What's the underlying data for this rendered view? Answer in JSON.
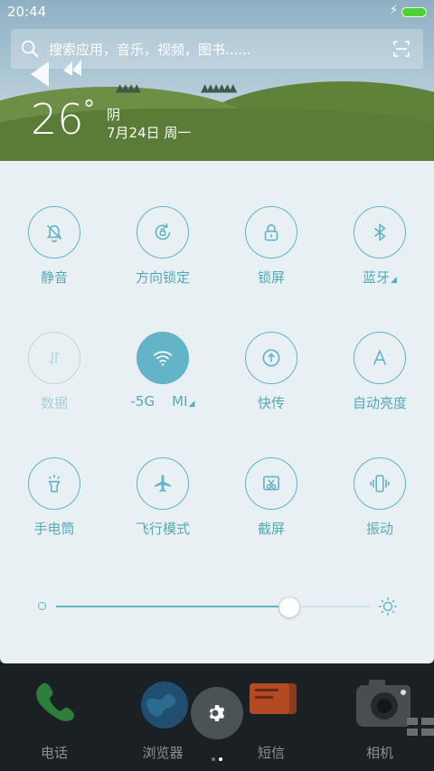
{
  "status": {
    "time": "20:44",
    "charging_icon": "bolt-icon",
    "battery_color": "#4cd137"
  },
  "search": {
    "placeholder": "搜索应用，音乐，视频，图书......"
  },
  "weather": {
    "temperature": "26",
    "degree": "°",
    "condition": "阴",
    "date": "7月24日 周一"
  },
  "toggles": [
    {
      "label": "静音",
      "icon": "bell-off-icon",
      "state": "off"
    },
    {
      "label": "方向锁定",
      "icon": "rotation-lock-icon",
      "state": "off"
    },
    {
      "label": "锁屏",
      "icon": "lock-icon",
      "state": "off"
    },
    {
      "label": "蓝牙",
      "icon": "bluetooth-icon",
      "state": "off",
      "has_submenu": true
    },
    {
      "label": "数据",
      "icon": "data-arrows-icon",
      "state": "disabled"
    },
    {
      "label": "-5G    MI",
      "icon": "wifi-icon",
      "state": "on",
      "has_submenu": true
    },
    {
      "label": "快传",
      "icon": "share-upload-icon",
      "state": "off"
    },
    {
      "label": "自动亮度",
      "icon": "auto-brightness-icon",
      "state": "off"
    },
    {
      "label": "手电筒",
      "icon": "flashlight-icon",
      "state": "off"
    },
    {
      "label": "飞行模式",
      "icon": "airplane-icon",
      "state": "off"
    },
    {
      "label": "截屏",
      "icon": "screenshot-icon",
      "state": "off"
    },
    {
      "label": "振动",
      "icon": "vibrate-icon",
      "state": "off"
    }
  ],
  "brightness": {
    "level": 0.74
  },
  "dock": {
    "apps": [
      {
        "label": "电话",
        "icon": "phone-icon"
      },
      {
        "label": "浏览器",
        "icon": "browser-icon"
      },
      {
        "label": "短信",
        "icon": "messages-icon"
      },
      {
        "label": "相机",
        "icon": "camera-icon"
      }
    ],
    "pager": {
      "pages": 2,
      "current": 2
    }
  },
  "colors": {
    "accent": "#62b4c6",
    "panel": "#e8f0f3",
    "dock_bg": "#1a2023"
  }
}
